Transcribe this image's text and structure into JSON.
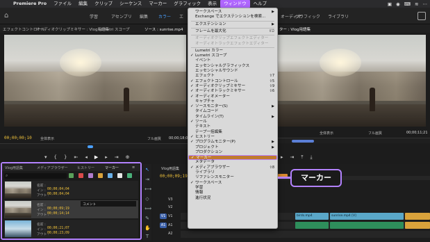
{
  "macbar": {
    "apple": "",
    "app": "Premiere Pro",
    "menus": [
      "ファイル",
      "編集",
      "クリップ",
      "シーケンス",
      "マーカー",
      "グラフィック",
      "表示",
      "ウィンドウ",
      "ヘルプ"
    ],
    "active_menu": "ウィンドウ",
    "status": [
      "▣",
      "◉",
      "⌨",
      "≋",
      "⋯"
    ]
  },
  "workspaces": [
    "学習",
    "アセンブリ",
    "編集",
    "カラー",
    "エ",
    "オーディオ",
    "グラフィック",
    "ライブラリ"
  ],
  "workspace_selected": "カラー",
  "panel_tabs": {
    "left": [
      "エフェクトコントロール",
      "オーディオクリップミキサー : Vlog用語集",
      "Lumetri スコープ",
      "ソース : sunrise.mp4"
    ],
    "right": [
      "ター : Vlog用語集"
    ]
  },
  "source_monitor": {
    "timecode": "00;00;00;10",
    "fit": "全体表示",
    "quality": "フル画質",
    "end_timecode": "00;00;18;01"
  },
  "program_monitor": {
    "fit": "全体表示",
    "quality": "フル画質",
    "timecode": "00;00;11;21"
  },
  "project": {
    "tabs": [
      "Vlog用語集",
      "メディアブラウザー",
      "ヒストリー",
      "マーカー"
    ],
    "active_tab": "マーカー",
    "swatch_colors": [
      "#5aa05a",
      "#d94a4a",
      "#b07ccd",
      "#d9a23b",
      "#6ab0e8",
      "#e8e8e8",
      "#4ab07a"
    ],
    "markers": [
      {
        "name_label": "名前 :",
        "name_value": "",
        "in_label": "イン :",
        "in_value": "00;00;04;04",
        "out_label": "アウト :",
        "out_value": "00;00;04;04",
        "comment": ""
      },
      {
        "name_label": "名前 :",
        "name_value": "",
        "in_label": "イン :",
        "in_value": "00;00;09;19",
        "out_label": "アウト :",
        "out_value": "00;00;14;14",
        "comment": "コメント"
      },
      {
        "name_label": "名前 :",
        "name_value": "",
        "in_label": "イン :",
        "in_value": "00;00;21;07",
        "out_label": "アウト :",
        "out_value": "00;00;23;09",
        "comment": ""
      }
    ]
  },
  "timeline": {
    "seq_label": "Vlog用語集",
    "timecode": "00;00;09;19",
    "tracks": [
      "V3",
      "V2",
      "V1",
      "A1",
      "A2"
    ],
    "clips": [
      "birds.mp4",
      "sunrise.mp4 [V]"
    ]
  },
  "window_menu": {
    "items": [
      {
        "label": "ワークスペース",
        "arrow": true
      },
      {
        "label": "Exchange でエクステンションを検索..."
      },
      {
        "sep": true
      },
      {
        "label": "エクステンション",
        "arrow": true
      },
      {
        "sep": true
      },
      {
        "label": "フレームを最大化",
        "shortcut": "⇧⎋"
      },
      {
        "sep": true
      },
      {
        "label": "オーディオクリップエフェクトエディター",
        "disabled": true
      },
      {
        "label": "オーディオトラックエフェクトエディター",
        "disabled": true
      },
      {
        "sep": true
      },
      {
        "label": "Lumetri カラー"
      },
      {
        "label": "Lumetri スコープ",
        "check": true
      },
      {
        "label": "イベント"
      },
      {
        "label": "エッセンシャルグラフィックス"
      },
      {
        "label": "エッセンシャルサウンド"
      },
      {
        "label": "エフェクト",
        "shortcut": "⇧7"
      },
      {
        "label": "エフェクトコントロール",
        "check": true,
        "shortcut": "⇧5"
      },
      {
        "label": "オーディオクリップミキサー",
        "check": true,
        "shortcut": "⇧9"
      },
      {
        "label": "オーディオトラックミキサー",
        "check": true,
        "shortcut": "⇧6"
      },
      {
        "label": "オーディオメーター",
        "check": true
      },
      {
        "label": "キャプチャ"
      },
      {
        "label": "ソースモニター(S)",
        "check": true,
        "arrow": true
      },
      {
        "label": "タイムコード"
      },
      {
        "label": "タイムライン(T)",
        "arrow": true
      },
      {
        "label": "ツール",
        "check": true
      },
      {
        "label": "テキスト"
      },
      {
        "label": "テープ一括編集"
      },
      {
        "label": "ヒストリー",
        "check": true
      },
      {
        "label": "プログラムモニター(P)",
        "check": true,
        "arrow": true
      },
      {
        "label": "プロジェクト",
        "arrow": true
      },
      {
        "label": "プロダクション"
      },
      {
        "label": "マーカー",
        "check": true,
        "highlight": true
      },
      {
        "label": "メタデータ"
      },
      {
        "label": "メディアブラウザー",
        "check": true,
        "shortcut": "⇧8"
      },
      {
        "label": "ライブラリ"
      },
      {
        "label": "リファレンスモニター"
      },
      {
        "label": "ワークスペース",
        "check": true
      },
      {
        "label": "学習"
      },
      {
        "label": "情報"
      },
      {
        "label": "進行状況"
      }
    ]
  },
  "callout": {
    "text": "マーカー"
  }
}
